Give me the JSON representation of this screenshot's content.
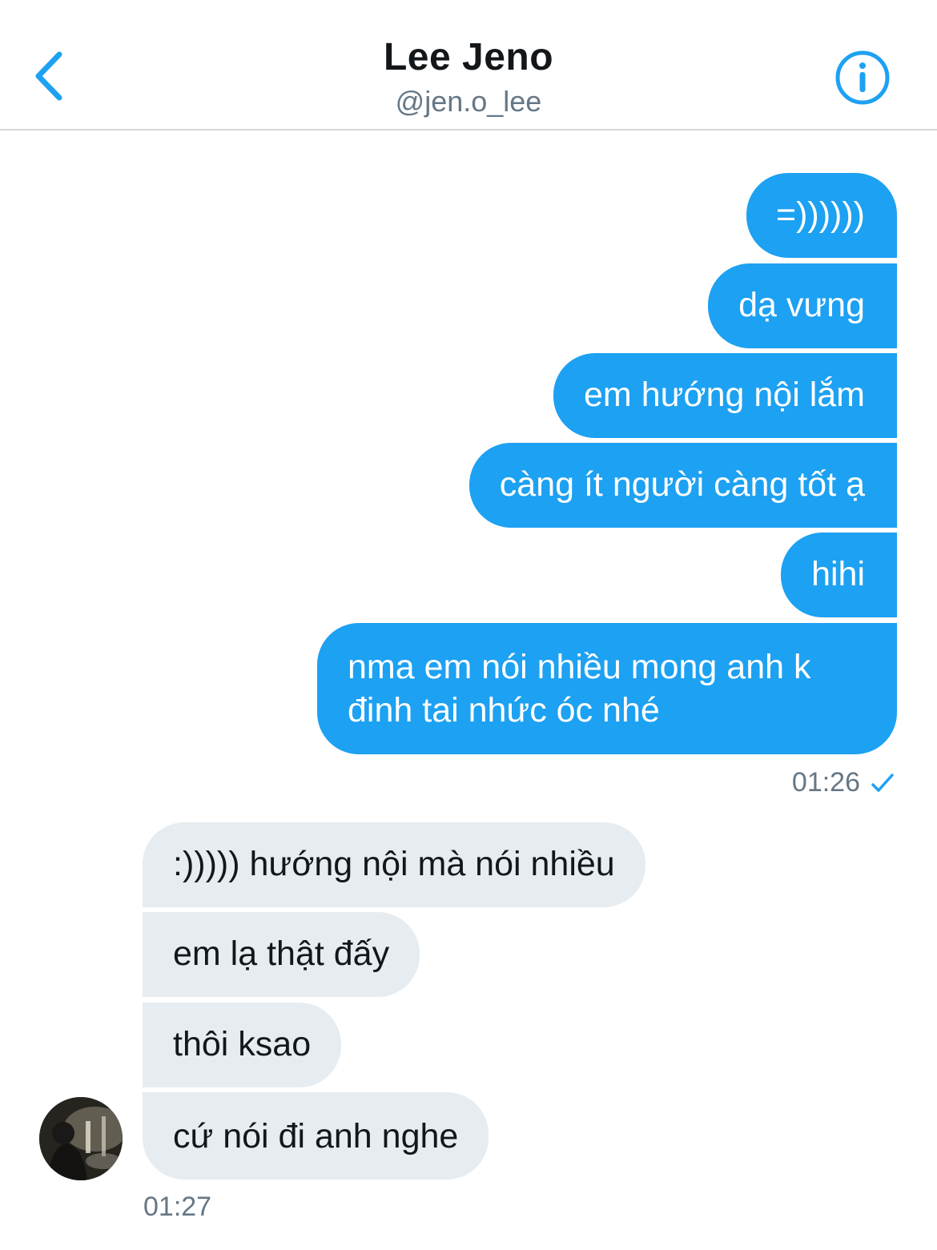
{
  "header": {
    "back_icon": "chevron-left-icon",
    "title": "Lee Jeno",
    "handle": "@jen.o_lee",
    "info_icon": "info-icon",
    "accent_color": "#1da1f2"
  },
  "outgoing": {
    "messages": [
      "=))))))",
      "dạ vưng",
      "em hướng nội lắm",
      "càng ít người càng tốt ạ",
      "hihi",
      "nma em nói nhiều mong anh k\nđinh tai nhức óc nhé"
    ],
    "time": "01:26",
    "status_icon": "checkmark-icon"
  },
  "incoming": {
    "messages": [
      ":))))) hướng nội mà nói nhiều",
      "em lạ thật đấy",
      "thôi ksao",
      "cứ nói đi anh nghe"
    ],
    "time": "01:27",
    "avatar": "avatar-photo"
  }
}
